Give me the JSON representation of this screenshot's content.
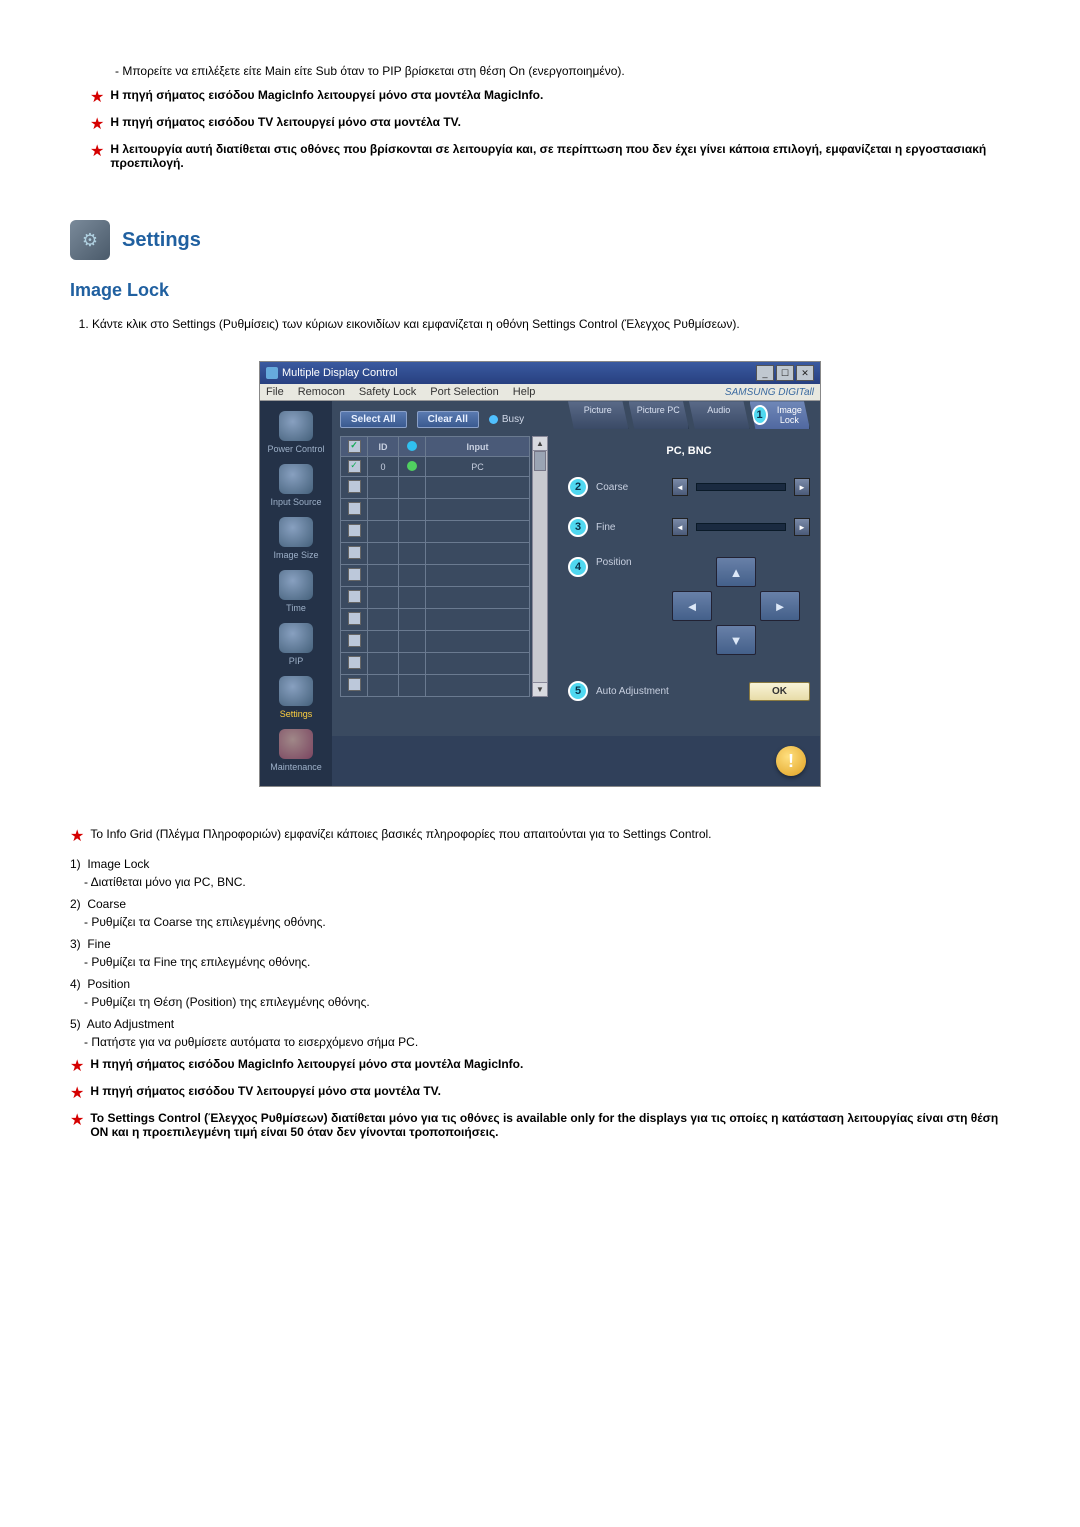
{
  "top": {
    "bullet": "- Μπορείτε να επιλέξετε είτε Main είτε Sub όταν το PIP βρίσκεται στη θέση On (ενεργοποιημένο).",
    "star1": "Η πηγή σήματος εισόδου MagicInfo λειτουργεί μόνο στα μοντέλα MagicInfo.",
    "star2": "Η πηγή σήματος εισόδου TV λειτουργεί μόνο στα μοντέλα TV.",
    "star3": "Η λειτουργία αυτή διατίθεται στις οθόνες που βρίσκονται σε λειτουργία και, σε περίπτωση που δεν έχει γίνει κάποια επιλογή, εμφανίζεται η εργοστασιακή προεπιλογή."
  },
  "section": {
    "title": "Settings",
    "subtitle": "Image Lock",
    "step1": "Κάντε κλικ στο Settings (Ρυθμίσεις) των κύριων εικονιδίων και εμφανίζεται η οθόνη Settings Control (Έλεγχος Ρυθμίσεων)."
  },
  "app": {
    "title": "Multiple Display Control",
    "menus": [
      "File",
      "Remocon",
      "Safety Lock",
      "Port Selection",
      "Help"
    ],
    "brand": "SAMSUNG DIGITall",
    "rail": [
      {
        "label": "Power Control"
      },
      {
        "label": "Input Source"
      },
      {
        "label": "Image Size"
      },
      {
        "label": "Time"
      },
      {
        "label": "PIP"
      },
      {
        "label": "Settings"
      },
      {
        "label": "Maintenance"
      }
    ],
    "selectAll": "Select All",
    "clearAll": "Clear All",
    "busy": "Busy",
    "gridHeaders": {
      "chk": "☑",
      "id": "ID",
      "status": "",
      "input": "Input"
    },
    "gridRows": [
      {
        "checked": true,
        "id": "0",
        "status": "green",
        "input": "PC"
      },
      {
        "checked": false
      },
      {
        "checked": false
      },
      {
        "checked": false
      },
      {
        "checked": false
      },
      {
        "checked": false
      },
      {
        "checked": false
      },
      {
        "checked": false
      },
      {
        "checked": false
      },
      {
        "checked": false
      },
      {
        "checked": false
      }
    ],
    "tabs": [
      "Picture",
      "Picture PC",
      "Audio",
      "Image Lock"
    ],
    "panelTitle": "PC, BNC",
    "labels": {
      "coarse": "Coarse",
      "fine": "Fine",
      "position": "Position",
      "auto": "Auto Adjustment"
    },
    "ok": "OK"
  },
  "desc": {
    "star0": "Το Info Grid (Πλέγμα Πληροφοριών) εμφανίζει κάποιες βασικές πληροφορίες που απαιτούνται για το Settings Control.",
    "i1": "Image Lock",
    "i1s": "- Διατίθεται μόνο για PC, BNC.",
    "i2": "Coarse",
    "i2s": "- Ρυθμίζει τα Coarse της επιλεγμένης οθόνης.",
    "i3": "Fine",
    "i3s": "- Ρυθμίζει τα Fine της επιλεγμένης οθόνης.",
    "i4": "Position",
    "i4s": "- Ρυθμίζει τη Θέση (Position) της επιλεγμένης οθόνης.",
    "i5": "Auto Adjustment",
    "i5s": "- Πατήστε για να ρυθμίσετε αυτόματα το εισερχόμενο σήμα PC.",
    "star1": "Η πηγή σήματος εισόδου MagicInfo λειτουργεί μόνο στα μοντέλα MagicInfo.",
    "star2": "Η πηγή σήματος εισόδου TV λειτουργεί μόνο στα μοντέλα TV.",
    "star3": "Το Settings Control (Έλεγχος Ρυθμίσεων) διατίθεται μόνο για τις οθόνες is available only for the displays για τις οποίες η κατάσταση λειτουργίας είναι στη θέση ON και η προεπιλεγμένη τιμή είναι 50 όταν δεν γίνονται τροποποιήσεις."
  }
}
